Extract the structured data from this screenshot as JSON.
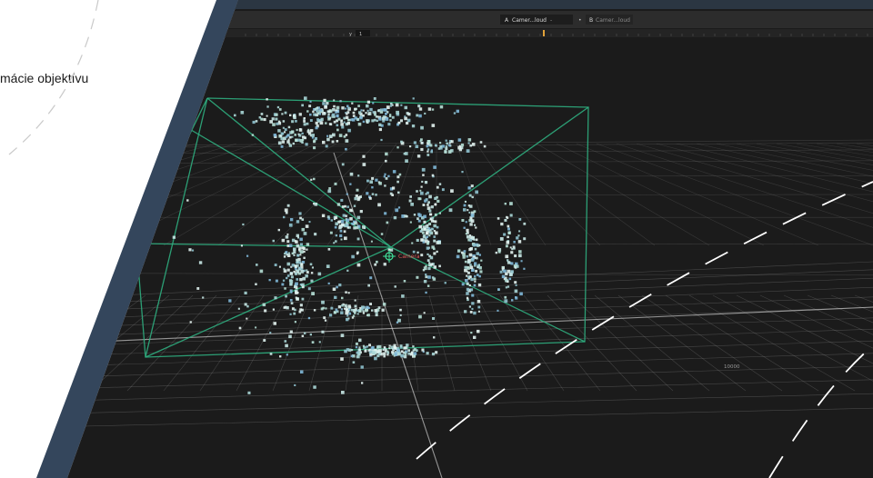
{
  "side_panel": {
    "caption": "mácie objektívu"
  },
  "viewer": {
    "input_a": {
      "letter": "A",
      "label": "Camer...loud",
      "dropdown": "-"
    },
    "input_b": {
      "letter": "B",
      "label": "Camer...loud"
    },
    "frame_label": "y",
    "frame_value": "1",
    "grid_label_far": "10000",
    "grid_label_near": "10000",
    "camera_label": "Camera"
  },
  "colors": {
    "viewport_bg": "#1b1b1b",
    "frame_blue": "#34465c",
    "bounding_box": "#2fae7f",
    "point_cloud": "#b9dcdc",
    "grid": "#8a8a8a"
  }
}
